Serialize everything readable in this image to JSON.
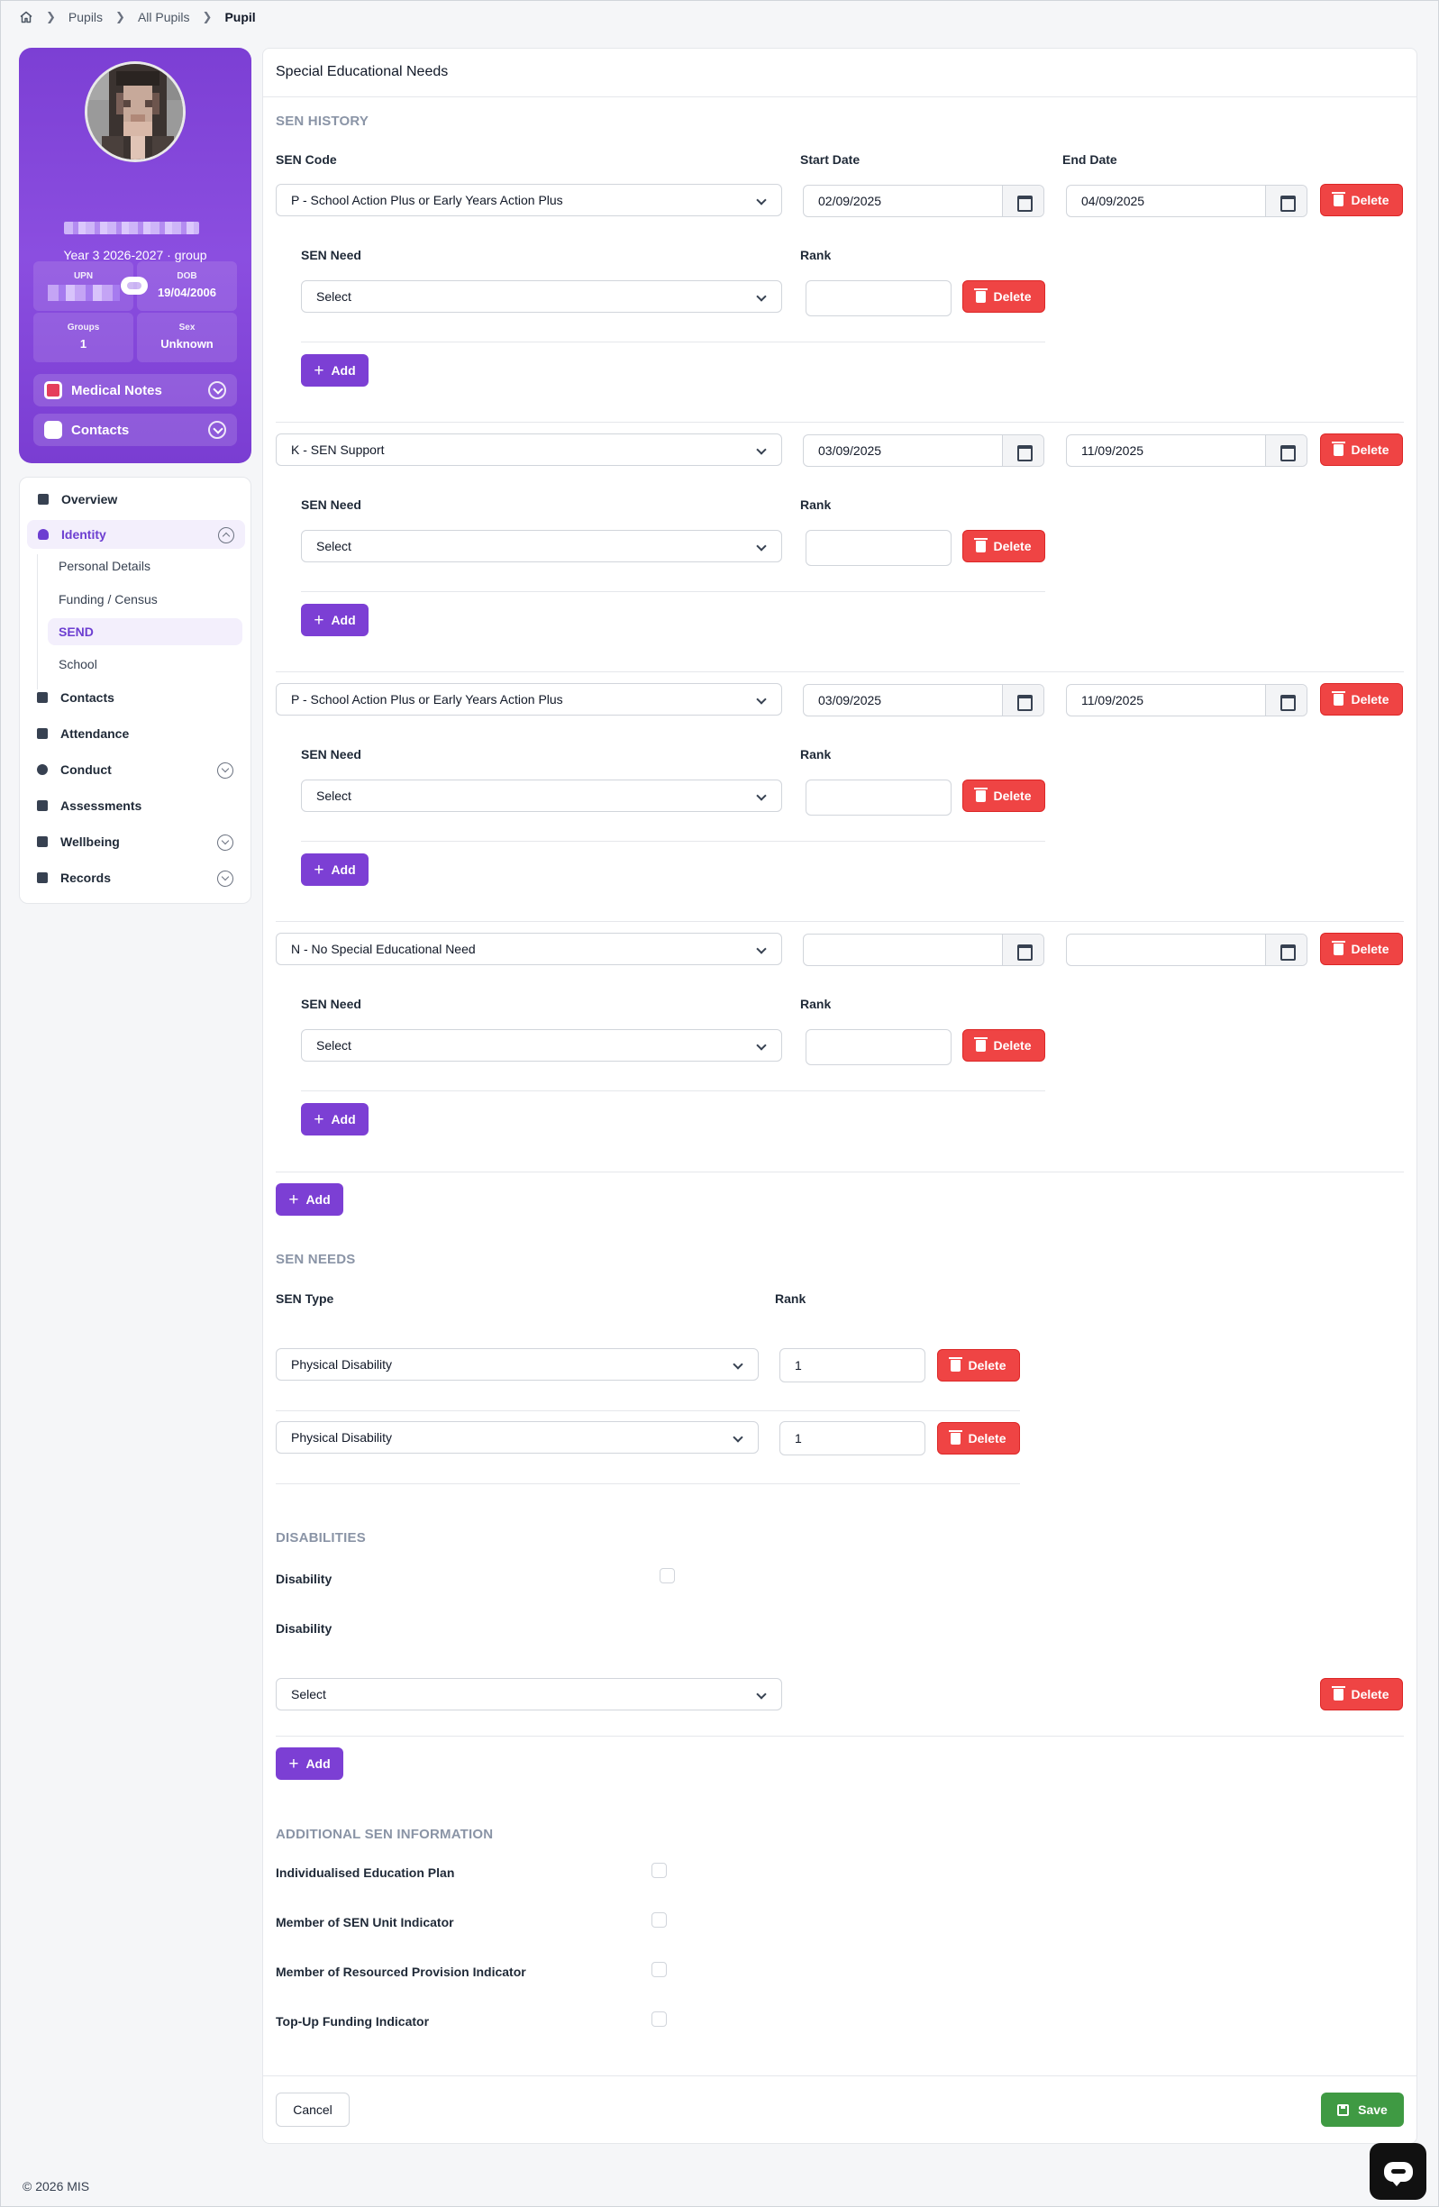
{
  "breadcrumb": {
    "items": [
      "Pupils",
      "All Pupils"
    ],
    "current": "Pupil"
  },
  "profile": {
    "year": "Year 3 2026-2027 · group",
    "stats": [
      {
        "label": "UPN",
        "value": ""
      },
      {
        "label": "DOB",
        "value": "19/04/2006"
      },
      {
        "label": "Groups",
        "value": "1"
      },
      {
        "label": "Sex",
        "value": "Unknown"
      }
    ],
    "buttons": {
      "medical": "Medical Notes",
      "contacts": "Contacts"
    }
  },
  "nav": {
    "items": [
      "Overview",
      "Identity",
      "Contacts",
      "Attendance",
      "Conduct",
      "Assessments",
      "Wellbeing",
      "Records"
    ],
    "identity_sub": [
      "Personal Details",
      "Funding / Census",
      "SEND",
      "School"
    ]
  },
  "footer": "© 2026 MIS",
  "card_title": "Special Educational Needs",
  "sen_history": {
    "heading": "SEN HISTORY",
    "col_code": "SEN Code",
    "col_start": "Start Date",
    "col_end": "End Date",
    "need_label": "SEN Need",
    "rank_label": "Rank",
    "select_placeholder": "Select",
    "delete": "Delete",
    "add": "Add",
    "entries": [
      {
        "code": "P - School Action Plus or Early Years Action Plus",
        "start": "02/09/2025",
        "end": "04/09/2025"
      },
      {
        "code": "K - SEN Support",
        "start": "03/09/2025",
        "end": "11/09/2025"
      },
      {
        "code": "P - School Action Plus or Early Years Action Plus",
        "start": "03/09/2025",
        "end": "11/09/2025"
      },
      {
        "code": "N - No Special Educational Need",
        "start": "",
        "end": ""
      }
    ]
  },
  "sen_needs": {
    "heading": "SEN NEEDS",
    "col_type": "SEN Type",
    "col_rank": "Rank",
    "rows": [
      {
        "type": "Physical Disability",
        "rank": "1"
      },
      {
        "type": "Physical Disability",
        "rank": "1"
      }
    ]
  },
  "disabilities": {
    "heading": "DISABILITIES",
    "label1": "Disability",
    "label2": "Disability",
    "select": "Select"
  },
  "additional": {
    "heading": "ADDITIONAL SEN INFORMATION",
    "items": [
      "Individualised Education Plan",
      "Member of SEN Unit Indicator",
      "Member of Resourced Provision Indicator",
      "Top-Up Funding Indicator"
    ]
  },
  "actions": {
    "cancel": "Cancel",
    "save": "Save"
  },
  "colors": {
    "accent": "#7c3fd4",
    "danger": "#ef4444",
    "success": "#3f9a43"
  }
}
